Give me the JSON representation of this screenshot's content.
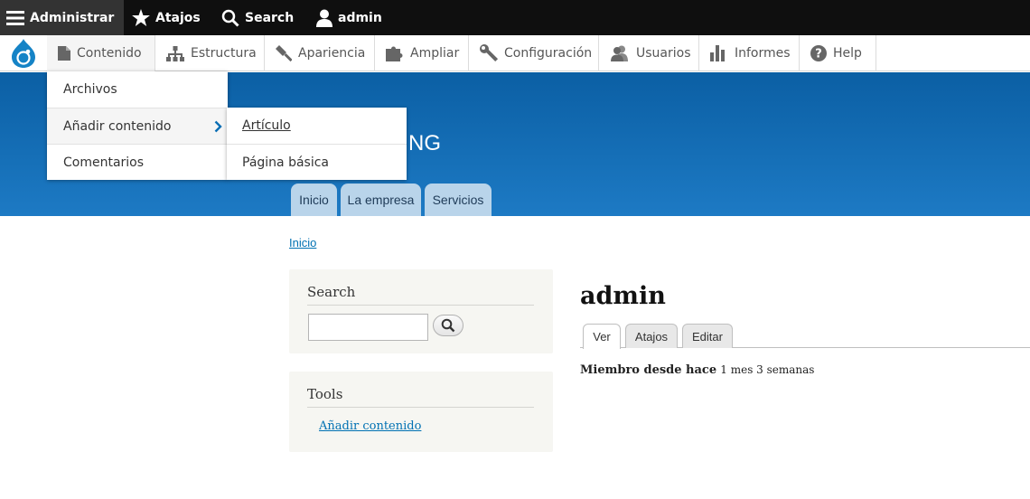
{
  "toolbar": {
    "admin_label": "Administrar",
    "shortcuts_label": "Atajos",
    "search_label": "Search",
    "user_label": "admin"
  },
  "tray": {
    "tabs": [
      {
        "label": "Contenido",
        "icon": "file-icon"
      },
      {
        "label": "Estructura",
        "icon": "sitemap-icon"
      },
      {
        "label": "Apariencia",
        "icon": "paint-icon"
      },
      {
        "label": "Ampliar",
        "icon": "puzzle-icon"
      },
      {
        "label": "Configuración",
        "icon": "wrench-icon"
      },
      {
        "label": "Usuarios",
        "icon": "users-icon"
      },
      {
        "label": "Informes",
        "icon": "bar-chart-icon"
      },
      {
        "label": "Help",
        "icon": "help-icon"
      }
    ]
  },
  "dropdown": {
    "items": [
      "Archivos",
      "Añadir contenido",
      "Comentarios"
    ]
  },
  "submenu": {
    "items": [
      "Artículo",
      "Página básica"
    ]
  },
  "header": {
    "site_name_visible": "NG",
    "nav": [
      "Inicio",
      "La empresa",
      "Servicios"
    ]
  },
  "breadcrumb": "Inicio",
  "search_block": {
    "title": "Search",
    "input_value": ""
  },
  "tools_block": {
    "title": "Tools",
    "link": "Añadir contenido"
  },
  "main": {
    "title": "admin",
    "tabs": [
      "Ver",
      "Atajos",
      "Editar"
    ],
    "member_label": "Miembro desde hace",
    "member_value": "1 mes 3 semanas"
  },
  "colors": {
    "header_top": "#0b5fa4",
    "header_bottom": "#1d7ac4",
    "link": "#0071b3",
    "toolbar": "#0f0f0f"
  }
}
